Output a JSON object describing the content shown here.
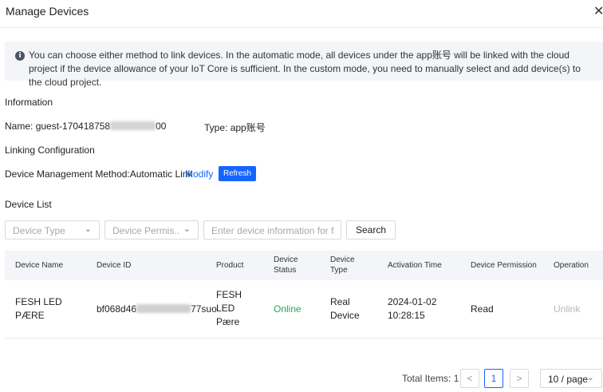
{
  "dialog": {
    "title": "Manage Devices",
    "close_glyph": "✕"
  },
  "alert": {
    "icon": "info-icon",
    "icon_glyph": "i",
    "text": "You can choose either method to link devices. In the automatic mode, all devices under the app账号 will be linked with the cloud project if the device allowance of your IoT Core is sufficient. In the custom mode, you need to manually select and add device(s) to the cloud project."
  },
  "information": {
    "heading": "Information",
    "name_label": "Name:",
    "name_prefix": "guest-170418758",
    "name_suffix": "00",
    "type_label": "Type:",
    "type_value": "app账号"
  },
  "linking": {
    "heading": "Linking Configuration",
    "method_text": "Device Management Method:Automatic Link",
    "modify_label": "Modify",
    "refresh_label": "Refresh"
  },
  "device_list": {
    "heading": "Device List",
    "filters": {
      "device_type_placeholder": "Device Type",
      "permission_placeholder": "Device Permis...",
      "search_placeholder": "Enter device information for f...",
      "search_button": "Search"
    },
    "columns": {
      "name": "Device Name",
      "id": "Device ID",
      "product": "Product",
      "status_l1": "Device",
      "status_l2": "Status",
      "type_l1": "Device",
      "type_l2": "Type",
      "activation": "Activation Time",
      "permission": "Device Permission",
      "operation": "Operation"
    },
    "rows": [
      {
        "name_l1": "FESH LED",
        "name_l2": "PÆRE",
        "id_prefix": "bf068d46",
        "id_suffix": "77suo",
        "product_l1": "FESH",
        "product_l2": "LED",
        "product_l3": "Pære",
        "status": "Online",
        "type_l1": "Real",
        "type_l2": "Device",
        "activation_l1": "2024-01-02",
        "activation_l2": "10:28:15",
        "permission": "Read",
        "operation": "Unlink"
      }
    ]
  },
  "pagination": {
    "total_label": "Total Items: 1",
    "prev_glyph": "<",
    "current_page": "1",
    "next_glyph": ">",
    "page_size": "10 / page"
  },
  "colors": {
    "accent": "#1664ff",
    "online": "#26a65b",
    "muted": "#a8a8a8"
  }
}
